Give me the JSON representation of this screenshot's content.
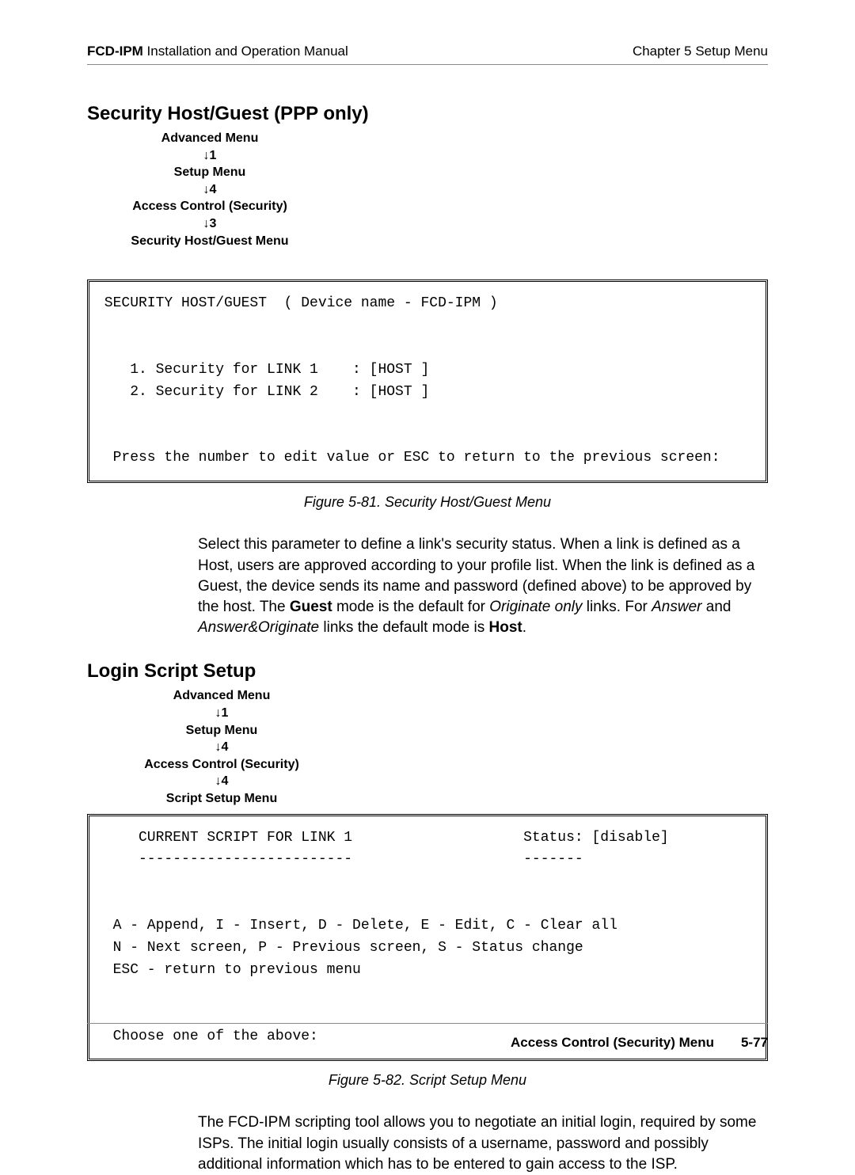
{
  "header": {
    "left_bold": "FCD-IPM",
    "left_rest": " Installation and Operation Manual",
    "right": "Chapter 5  Setup Menu"
  },
  "sec1": {
    "title": "Security Host/Guest (PPP only)",
    "nav1": "Advanced Menu",
    "nav1a": "↓1",
    "nav2": "Setup Menu",
    "nav2a": "↓4",
    "nav3": "Access Control (Security)",
    "nav3a": "↓3",
    "nav4": "Security Host/Guest Menu",
    "term": " SECURITY HOST/GUEST  ( Device name - FCD-IPM )\n\n\n    1. Security for LINK 1    : [HOST ]\n    2. Security for LINK 2    : [HOST ]\n\n\n  Press the number to edit value or ESC to return to the previous screen:",
    "caption": "Figure 5-81.  Security Host/Guest Menu",
    "para_a": "Select this parameter to define a link's security status. When a link is defined as a Host, users are approved according to your profile list. When the link is defined as a Guest, the device sends its name and password (defined above) to be approved by the host. The ",
    "para_b_bold": "Guest",
    "para_c": " mode is the default for ",
    "para_d_i": "Originate only",
    "para_e": " links. For ",
    "para_f_i": "Answer",
    "para_g": " and ",
    "para_h_i": "Answer&Originate",
    "para_i": " links the default mode is ",
    "para_j_bold": "Host",
    "para_k": "."
  },
  "sec2": {
    "title": "Login Script Setup",
    "nav1": "Advanced Menu",
    "nav1a": "↓1",
    "nav2": "Setup Menu",
    "nav2a": "↓4",
    "nav3": "Access Control (Security)",
    "nav3a": "↓4",
    "nav4": "Script Setup Menu",
    "term": "     CURRENT SCRIPT FOR LINK 1                    Status: [disable]\n     -------------------------                    -------\n\n\n  A - Append, I - Insert, D - Delete, E - Edit, C - Clear all\n  N - Next screen, P - Previous screen, S - Status change\n  ESC - return to previous menu\n\n\n  Choose one of the above:",
    "caption": "Figure 5-82.  Script Setup Menu",
    "para": "The FCD-IPM scripting tool allows you to negotiate an initial login, required by some ISPs. The initial login usually consists of a username, password and possibly additional information which has to be entered to gain access to the ISP."
  },
  "footer": {
    "label": "Access Control (Security) Menu",
    "page": "5-77"
  }
}
